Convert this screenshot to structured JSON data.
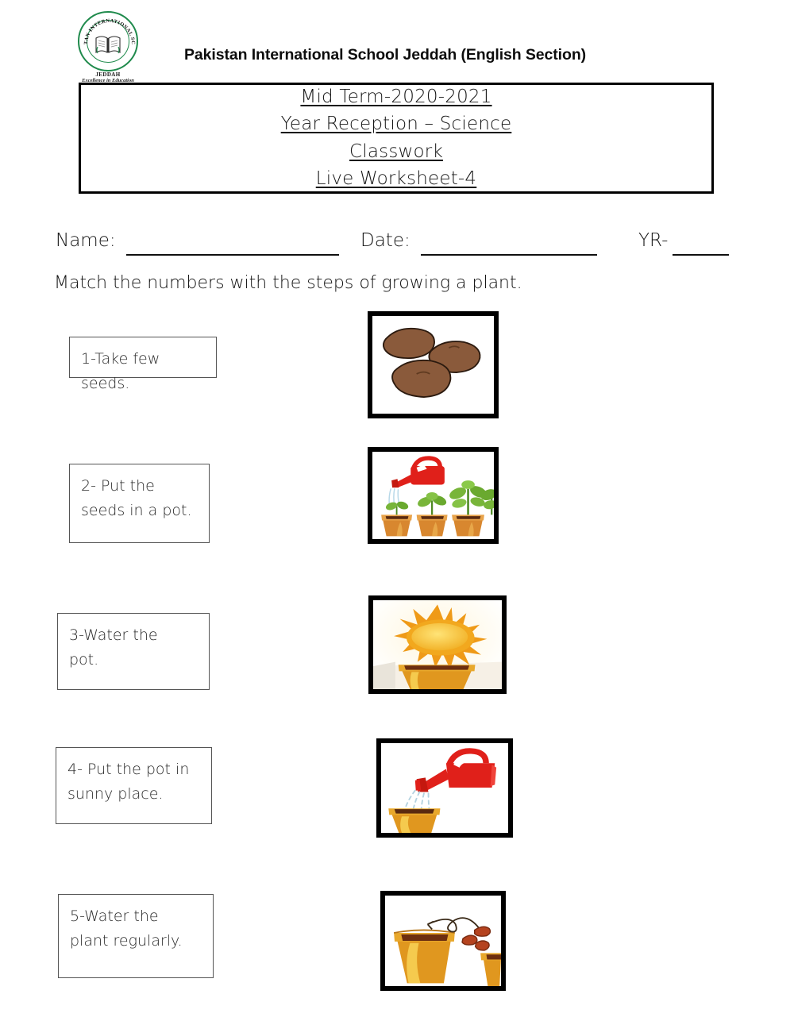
{
  "header": {
    "school_title": "Pakistan International School Jeddah (English Section)",
    "logo": {
      "arc_text": "PAKISTAN INTERNATIONAL SCHOOL",
      "city": "JEDDAH",
      "tagline": "Excellence in Education",
      "brand_color": "#1f8a4c"
    }
  },
  "title_box": {
    "lines": [
      "Mid Term-2020-2021",
      "Year Reception – Science",
      "Classwork",
      "Live Worksheet-4"
    ]
  },
  "fields": {
    "name_label": "Name:",
    "name_value": "",
    "date_label": "Date:",
    "date_value": "",
    "yr_label": "YR-",
    "yr_value": ""
  },
  "instruction": "Match the numbers with the steps of growing a plant.",
  "items": [
    {
      "label": "1-Take few seeds.",
      "image_name": "seeds-image",
      "image_alt": "Three brown bean seeds",
      "colors": {
        "seed": "#8a5a3b",
        "seed_shade": "#6f4528",
        "bg": "#ffffff"
      }
    },
    {
      "label": "2- Put the\nseeds in a pot.",
      "image_name": "pots-with-plants-image",
      "image_alt": "Three pots with growing plants and a red watering can",
      "colors": {
        "pot": "#d8872f",
        "pot_light": "#f0b554",
        "leaf": "#6aa92f",
        "can": "#e0201a",
        "bg": "#ffffff"
      }
    },
    {
      "label": "3-Water the\npot.",
      "image_name": "sun-over-pot-image",
      "image_alt": "Bright sun shining above an empty pot",
      "colors": {
        "sun": "#f0a01c",
        "sun_core": "#fcd34a",
        "pot": "#e0971f",
        "soil": "#6d2f10",
        "bg": "#fdf6ec"
      }
    },
    {
      "label": "4- Put the pot in\nsunny place.",
      "image_name": "watering-can-pot-image",
      "image_alt": "Red watering can pouring water into a pot",
      "colors": {
        "can": "#e0201a",
        "pot": "#e0971f",
        "water": "#9fc6d8",
        "soil": "#5a2a10",
        "bg": "#ffffff"
      }
    },
    {
      "label": "5-Water the\nplant regularly.",
      "image_name": "seeds-into-pot-image",
      "image_alt": "Seeds being dropped into a large pot",
      "colors": {
        "pot": "#e0971f",
        "pot_light": "#f4c140",
        "seed": "#b5431f",
        "soil": "#6d2f10",
        "bg": "#ffffff"
      }
    }
  ]
}
